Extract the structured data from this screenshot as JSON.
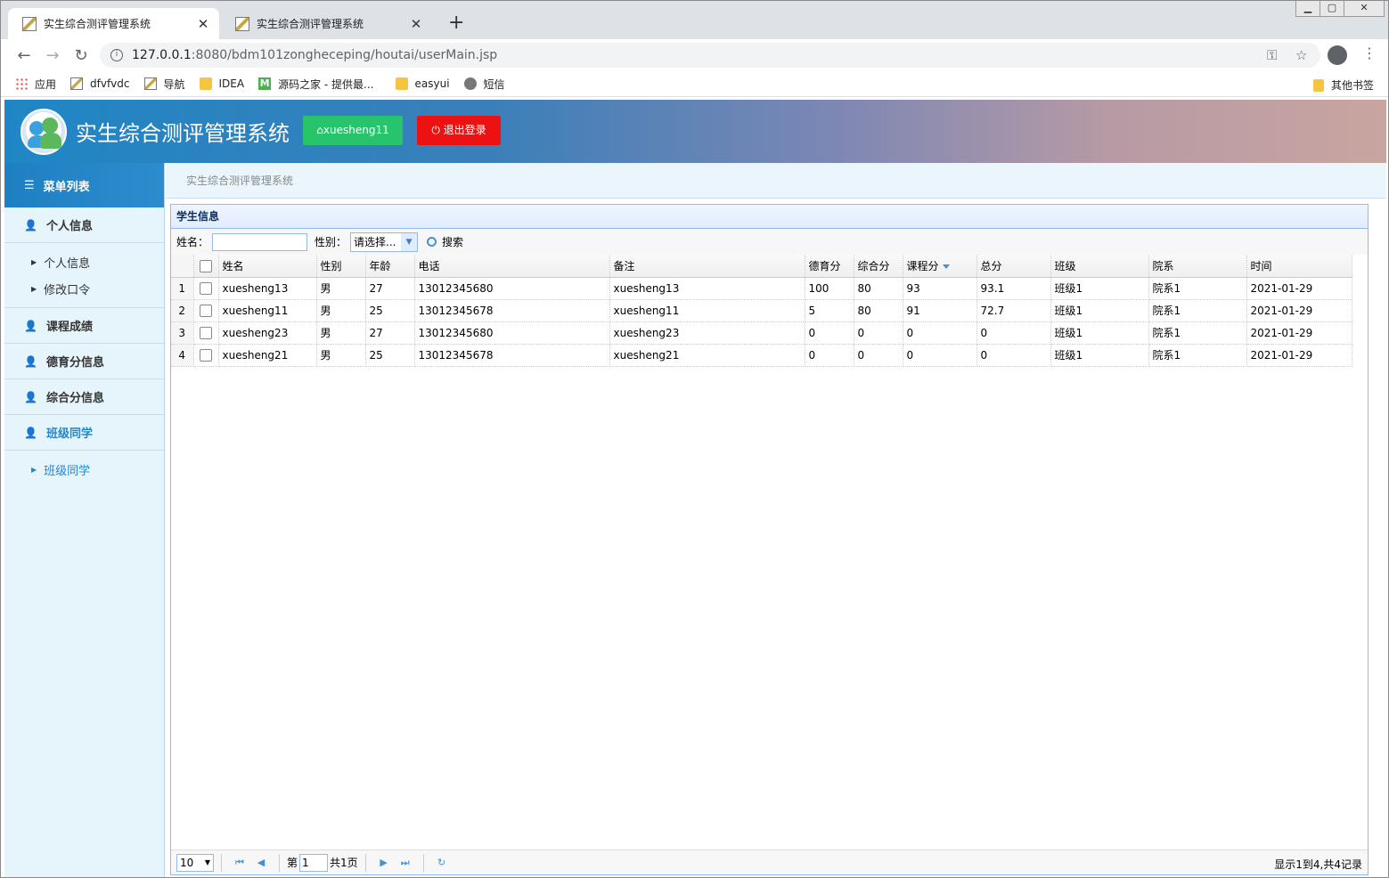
{
  "browser": {
    "tabs": [
      {
        "title": "实生综合测评管理系统",
        "active": true
      },
      {
        "title": "实生综合测评管理系统",
        "active": false
      }
    ],
    "url_host": "127.0.0.1",
    "url_path": ":8080/bdm101zongheceping/houtai/userMain.jsp",
    "bookmarks": [
      "应用",
      "dfvfvdc",
      "导航",
      "IDEA",
      "源码之家 - 提供最...",
      "easyui",
      "短信"
    ],
    "other_bookmarks": "其他书签"
  },
  "header": {
    "title": "实生综合测评管理系统",
    "user_label": "xuesheng11",
    "logout_label": "退出登录",
    "colors": {
      "user_btn": "#27c46b",
      "logout_btn": "#ee1111",
      "accent": "#1e88d0"
    }
  },
  "sidebar": {
    "title": "菜单列表",
    "sections": [
      {
        "label": "个人信息",
        "items": [
          "个人信息",
          "修改口令"
        ]
      },
      {
        "label": "课程成绩",
        "items": []
      },
      {
        "label": "德育分信息",
        "items": []
      },
      {
        "label": "综合分信息",
        "items": []
      },
      {
        "label": "班级同学",
        "items": [
          "班级同学"
        ],
        "active": true
      }
    ]
  },
  "breadcrumb": "实生综合测评管理系统",
  "panel": {
    "title": "学生信息",
    "search": {
      "name_label": "姓名：",
      "name_value": "",
      "sex_label": "性别：",
      "sex_value": "请选择...",
      "button": "搜索"
    },
    "columns": [
      "姓名",
      "性别",
      "年龄",
      "电话",
      "备注",
      "德育分",
      "综合分",
      "课程分",
      "总分",
      "班级",
      "院系",
      "时间"
    ],
    "sorted_column": "课程分",
    "rows": [
      [
        "1",
        "xuesheng13",
        "男",
        "27",
        "13012345680",
        "xuesheng13",
        "100",
        "80",
        "93",
        "93.1",
        "班级1",
        "院系1",
        "2021-01-29"
      ],
      [
        "2",
        "xuesheng11",
        "男",
        "25",
        "13012345678",
        "xuesheng11",
        "5",
        "80",
        "91",
        "72.7",
        "班级1",
        "院系1",
        "2021-01-29"
      ],
      [
        "3",
        "xuesheng23",
        "男",
        "27",
        "13012345680",
        "xuesheng23",
        "0",
        "0",
        "0",
        "0",
        "班级1",
        "院系1",
        "2021-01-29"
      ],
      [
        "4",
        "xuesheng21",
        "男",
        "25",
        "13012345678",
        "xuesheng21",
        "0",
        "0",
        "0",
        "0",
        "班级1",
        "院系1",
        "2021-01-29"
      ]
    ],
    "pager": {
      "page_size": "10",
      "page_prefix": "第",
      "page_num": "1",
      "page_total": "共1页",
      "info": "显示1到4,共4记录"
    }
  }
}
